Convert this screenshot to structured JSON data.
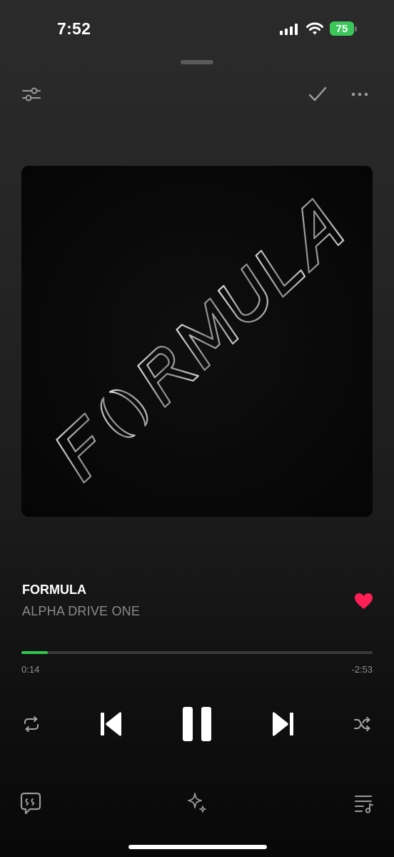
{
  "status_bar": {
    "time": "7:52",
    "battery_level": "75",
    "signal_bars": 4,
    "battery_color": "#3cc75a"
  },
  "header": {
    "equalizer_icon": "sliders-icon",
    "check_icon": "checkmark-icon",
    "more_icon": "ellipsis-icon"
  },
  "artwork": {
    "lettering": "FORMULA"
  },
  "track": {
    "title": "FORMULA",
    "artist": "ALPHA DRIVE ONE",
    "liked": true,
    "like_color": "#ff1f55"
  },
  "progress": {
    "elapsed": "0:14",
    "remaining": "-2:53",
    "fraction": 0.075,
    "fill_color": "#2fc54f"
  },
  "controls": {
    "repeat_icon": "repeat-icon",
    "previous_icon": "skip-back-icon",
    "play_pause_icon": "pause-icon",
    "next_icon": "skip-forward-icon",
    "shuffle_icon": "shuffle-icon"
  },
  "bottom_bar": {
    "lyrics_icon": "lyrics-quote-icon",
    "sparkle_icon": "sparkle-icon",
    "queue_icon": "queue-list-icon"
  }
}
